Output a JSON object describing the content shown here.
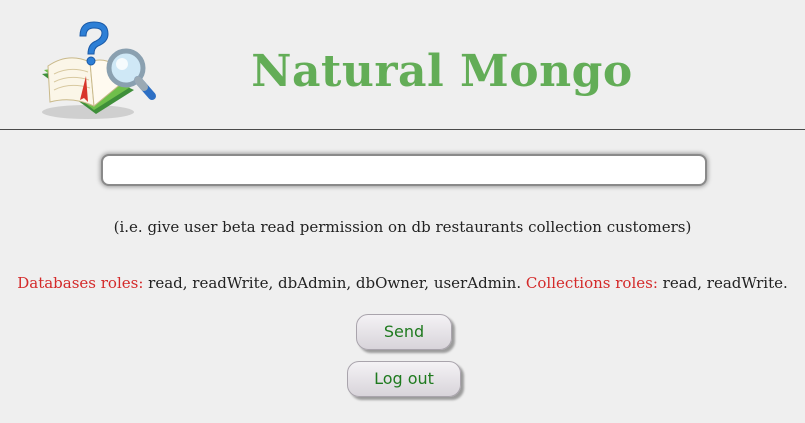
{
  "header": {
    "title": "Natural Mongo",
    "logo_icon": "book-magnifier-question-icon"
  },
  "query": {
    "value": "",
    "placeholder": ""
  },
  "hint": "(i.e. give user beta read permission on db restaurants collection customers)",
  "roles": {
    "db_label": "Databases roles:",
    "db_values": " read, readWrite, dbAdmin, dbOwner, userAdmin. ",
    "coll_label": "Collections roles:",
    "coll_values": " read, readWrite."
  },
  "buttons": {
    "send": "Send",
    "logout": "Log out"
  },
  "colors": {
    "title": "#63ad57",
    "role_label": "#d42a2a",
    "button_text": "#1f7a1f"
  }
}
